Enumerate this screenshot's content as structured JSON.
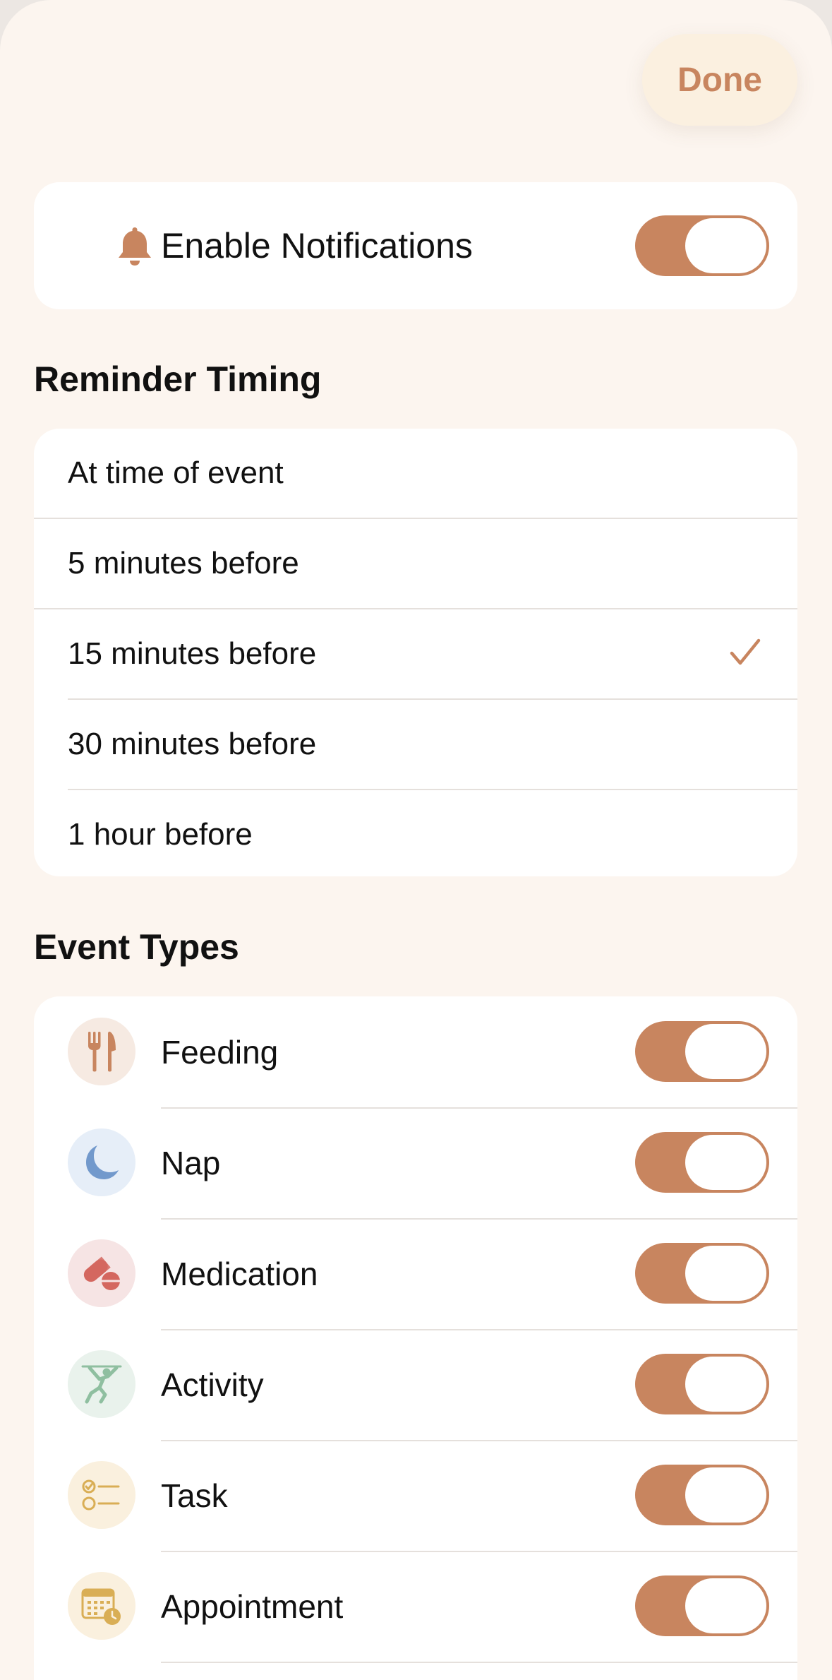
{
  "header": {
    "done_label": "Done"
  },
  "notifications": {
    "label": "Enable Notifications",
    "enabled": true,
    "icon": "bell-icon"
  },
  "reminder_timing": {
    "title": "Reminder Timing",
    "options": [
      {
        "label": "At time of event",
        "selected": false
      },
      {
        "label": "5 minutes before",
        "selected": false
      },
      {
        "label": "15 minutes before",
        "selected": true
      },
      {
        "label": "30 minutes before",
        "selected": false
      },
      {
        "label": "1 hour before",
        "selected": false
      }
    ]
  },
  "event_types": {
    "title": "Event Types",
    "items": [
      {
        "label": "Feeding",
        "icon": "fork-knife-icon",
        "enabled": true
      },
      {
        "label": "Nap",
        "icon": "moon-icon",
        "enabled": true
      },
      {
        "label": "Medication",
        "icon": "pills-icon",
        "enabled": true
      },
      {
        "label": "Activity",
        "icon": "activity-figure-icon",
        "enabled": true
      },
      {
        "label": "Task",
        "icon": "checklist-icon",
        "enabled": true
      },
      {
        "label": "Appointment",
        "icon": "calendar-clock-icon",
        "enabled": true
      }
    ]
  },
  "colors": {
    "accent": "#C8855F",
    "sheet_background": "#FCF5EF",
    "card_background": "#FFFFFF",
    "separator": "#E5E0DC"
  }
}
